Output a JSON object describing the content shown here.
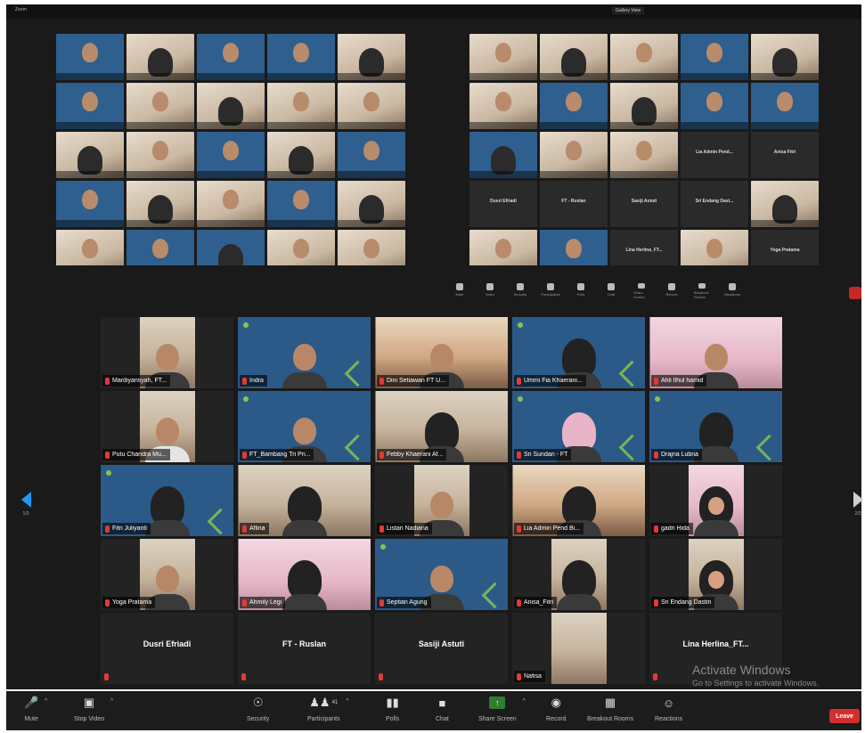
{
  "collage": {
    "app_title": "Zoom",
    "view_label": "Gallery View",
    "left_tiles": [
      {
        "kind": "blue"
      },
      {
        "kind": "photo"
      },
      {
        "kind": "blue"
      },
      {
        "kind": "blue"
      },
      {
        "kind": "photo"
      },
      {
        "kind": "blue"
      },
      {
        "kind": "photo"
      },
      {
        "kind": "photo"
      },
      {
        "kind": "photo"
      },
      {
        "kind": "photo"
      },
      {
        "kind": "photo"
      },
      {
        "kind": "photo"
      },
      {
        "kind": "blue"
      },
      {
        "kind": "photo"
      },
      {
        "kind": "blue"
      },
      {
        "kind": "blue"
      },
      {
        "kind": "photo"
      },
      {
        "kind": "photo"
      },
      {
        "kind": "blue"
      },
      {
        "kind": "photo"
      },
      {
        "kind": "photo"
      },
      {
        "kind": "blue"
      },
      {
        "kind": "blue"
      },
      {
        "kind": "photo"
      },
      {
        "kind": "photo"
      }
    ],
    "right_tiles": [
      {
        "kind": "photo"
      },
      {
        "kind": "photo"
      },
      {
        "kind": "photo"
      },
      {
        "kind": "blue"
      },
      {
        "kind": "photo"
      },
      {
        "kind": "photo"
      },
      {
        "kind": "blue"
      },
      {
        "kind": "photo"
      },
      {
        "kind": "blue"
      },
      {
        "kind": "blue"
      },
      {
        "kind": "blue"
      },
      {
        "kind": "photo"
      },
      {
        "kind": "photo"
      },
      {
        "kind": "dark",
        "name": "Lia Admin Pend..."
      },
      {
        "kind": "dark",
        "name": "Anisa Fitri"
      },
      {
        "kind": "dark",
        "name": "Dusri Efriadi"
      },
      {
        "kind": "dark",
        "name": "FT - Ruslan"
      },
      {
        "kind": "dark",
        "name": "Sasiji Astuti"
      },
      {
        "kind": "dark",
        "name": "Sri Endang Dast..."
      },
      {
        "kind": "photo"
      },
      {
        "kind": "photo"
      },
      {
        "kind": "blue"
      },
      {
        "kind": "dark",
        "name": "Lina Herlina_FT..."
      },
      {
        "kind": "photo"
      },
      {
        "kind": "dark",
        "name": "Yoga Pratama"
      }
    ]
  },
  "mini_controls": [
    "Mute",
    "Video",
    "Security",
    "Participants",
    "Polls",
    "Chat",
    "Share Screen",
    "Record",
    "Breakout Rooms",
    "Reactions"
  ],
  "participants": [
    {
      "name": "Mardiyansyah, FT...",
      "style": "photo",
      "cam": "w1",
      "person": "head"
    },
    {
      "name": "Indra",
      "style": "blue",
      "person": "head"
    },
    {
      "name": "Dini Setiawan FT U...",
      "style": "photo",
      "cam": "w3",
      "person": "head",
      "tone": "warm"
    },
    {
      "name": "Ummi Fia Khaerani...",
      "style": "blue",
      "person": "hijab"
    },
    {
      "name": "Ahli Ilhul hamid",
      "style": "photo",
      "cam": "w3",
      "person": "head",
      "tone": "pink"
    },
    {
      "name": "Putu Chandra Mu...",
      "style": "photo",
      "cam": "w1",
      "person": "head",
      "body": "white"
    },
    {
      "name": "FT_Bambang Tri Pri...",
      "style": "blue",
      "person": "head"
    },
    {
      "name": "Febby Khaerani Af...",
      "style": "photo",
      "cam": "w3",
      "person": "hijab"
    },
    {
      "name": "Sri Sundari - FT",
      "style": "blue",
      "person": "hijab-pink"
    },
    {
      "name": "Drajna Lubna",
      "style": "blue",
      "person": "hijab"
    },
    {
      "name": "Fitri Juliyanti",
      "style": "blue",
      "person": "hijab"
    },
    {
      "name": "Aflina",
      "style": "photo",
      "cam": "w3",
      "person": "hijab"
    },
    {
      "name": "Listari Nadiana",
      "style": "photo",
      "cam": "w1",
      "person": "head"
    },
    {
      "name": "Lia Admin Pend Bi...",
      "style": "photo",
      "cam": "w3",
      "person": "hijab",
      "tone": "warm"
    },
    {
      "name": "gadri Hida",
      "style": "photo",
      "cam": "w1",
      "person": "hijab-pinkface",
      "tone": "pink"
    },
    {
      "name": "Yoga Pratama",
      "style": "photo",
      "cam": "w1",
      "person": "head"
    },
    {
      "name": "Ahmily Legi",
      "style": "photo",
      "cam": "w3",
      "person": "hijab",
      "tone": "pink"
    },
    {
      "name": "Septian Agung",
      "style": "blue",
      "person": "head"
    },
    {
      "name": "Anisa_Fitri",
      "style": "photo",
      "cam": "w1",
      "person": "hijab"
    },
    {
      "name": "Sri Endang Dastin",
      "style": "photo",
      "cam": "w1",
      "person": "hijab-pinkface"
    },
    {
      "name": "Dusri Efriadi",
      "style": "off"
    },
    {
      "name": "FT - Ruslan",
      "style": "off"
    },
    {
      "name": "Sasiji Astuti",
      "style": "off"
    },
    {
      "name": "Nafisa",
      "style": "photo",
      "cam": "w1",
      "person": "none"
    },
    {
      "name": "Lina Herlina_FT...",
      "style": "off"
    }
  ],
  "nav": {
    "prev_page": "1/3",
    "next_page": "2/3"
  },
  "watermark": {
    "title": "Activate Windows",
    "subtitle": "Go to Settings to activate Windows."
  },
  "toolbar": {
    "mute": "Mute",
    "stop_video": "Stop Video",
    "security": "Security",
    "participants": "Participants",
    "participants_count": "41",
    "polls": "Polls",
    "chat": "Chat",
    "share_screen": "Share Screen",
    "record": "Record",
    "breakout_rooms": "Breakout Rooms",
    "reactions": "Reactions",
    "leave": "Leave"
  },
  "colors": {
    "accent_green": "#2e7d32",
    "leave_red": "#d32f2f",
    "tile_blue": "#2c5a88",
    "nav_blue": "#2196f3"
  }
}
